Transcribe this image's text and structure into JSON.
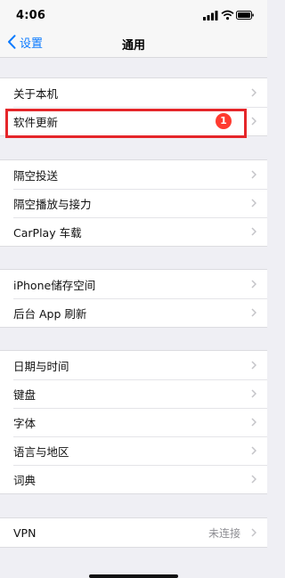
{
  "status_bar": {
    "time": "4:06"
  },
  "nav": {
    "back_label": "设置",
    "title": "通用"
  },
  "groups": [
    [
      {
        "label": "关于本机"
      },
      {
        "label": "软件更新",
        "badge": "1",
        "highlighted": true
      }
    ],
    [
      {
        "label": "隔空投送"
      },
      {
        "label": "隔空播放与接力"
      },
      {
        "label": "CarPlay 车载"
      }
    ],
    [
      {
        "label": "iPhone储存空间"
      },
      {
        "label": "后台 App 刷新"
      }
    ],
    [
      {
        "label": "日期与时间"
      },
      {
        "label": "键盘"
      },
      {
        "label": "字体"
      },
      {
        "label": "语言与地区"
      },
      {
        "label": "词典"
      }
    ],
    [
      {
        "label": "VPN",
        "value": "未连接"
      }
    ]
  ],
  "colors": {
    "accent": "#0a7aff",
    "badge": "#ff3b30",
    "highlight": "#e5262a",
    "background": "#efeff4"
  }
}
